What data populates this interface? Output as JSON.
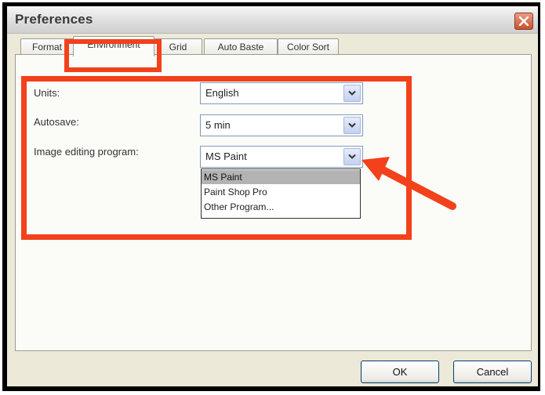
{
  "window": {
    "title": "Preferences"
  },
  "tabs": [
    {
      "label": "Format"
    },
    {
      "label": "Environment"
    },
    {
      "label": "Grid"
    },
    {
      "label": "Auto Baste"
    },
    {
      "label": "Color Sort"
    }
  ],
  "settings": {
    "units": {
      "label": "Units:",
      "value": "English"
    },
    "autosave": {
      "label": "Autosave:",
      "value": "5 min"
    },
    "image_editor": {
      "label": "Image editing program:",
      "value": "MS Paint",
      "options": [
        "MS Paint",
        "Paint Shop Pro",
        "Other Program..."
      ]
    }
  },
  "buttons": {
    "ok": "OK",
    "cancel": "Cancel"
  },
  "annotation_color": "#f2411b",
  "icons": {
    "close": "close-icon",
    "dropdown": "chevron-down-icon",
    "callout": "arrow-callout"
  }
}
